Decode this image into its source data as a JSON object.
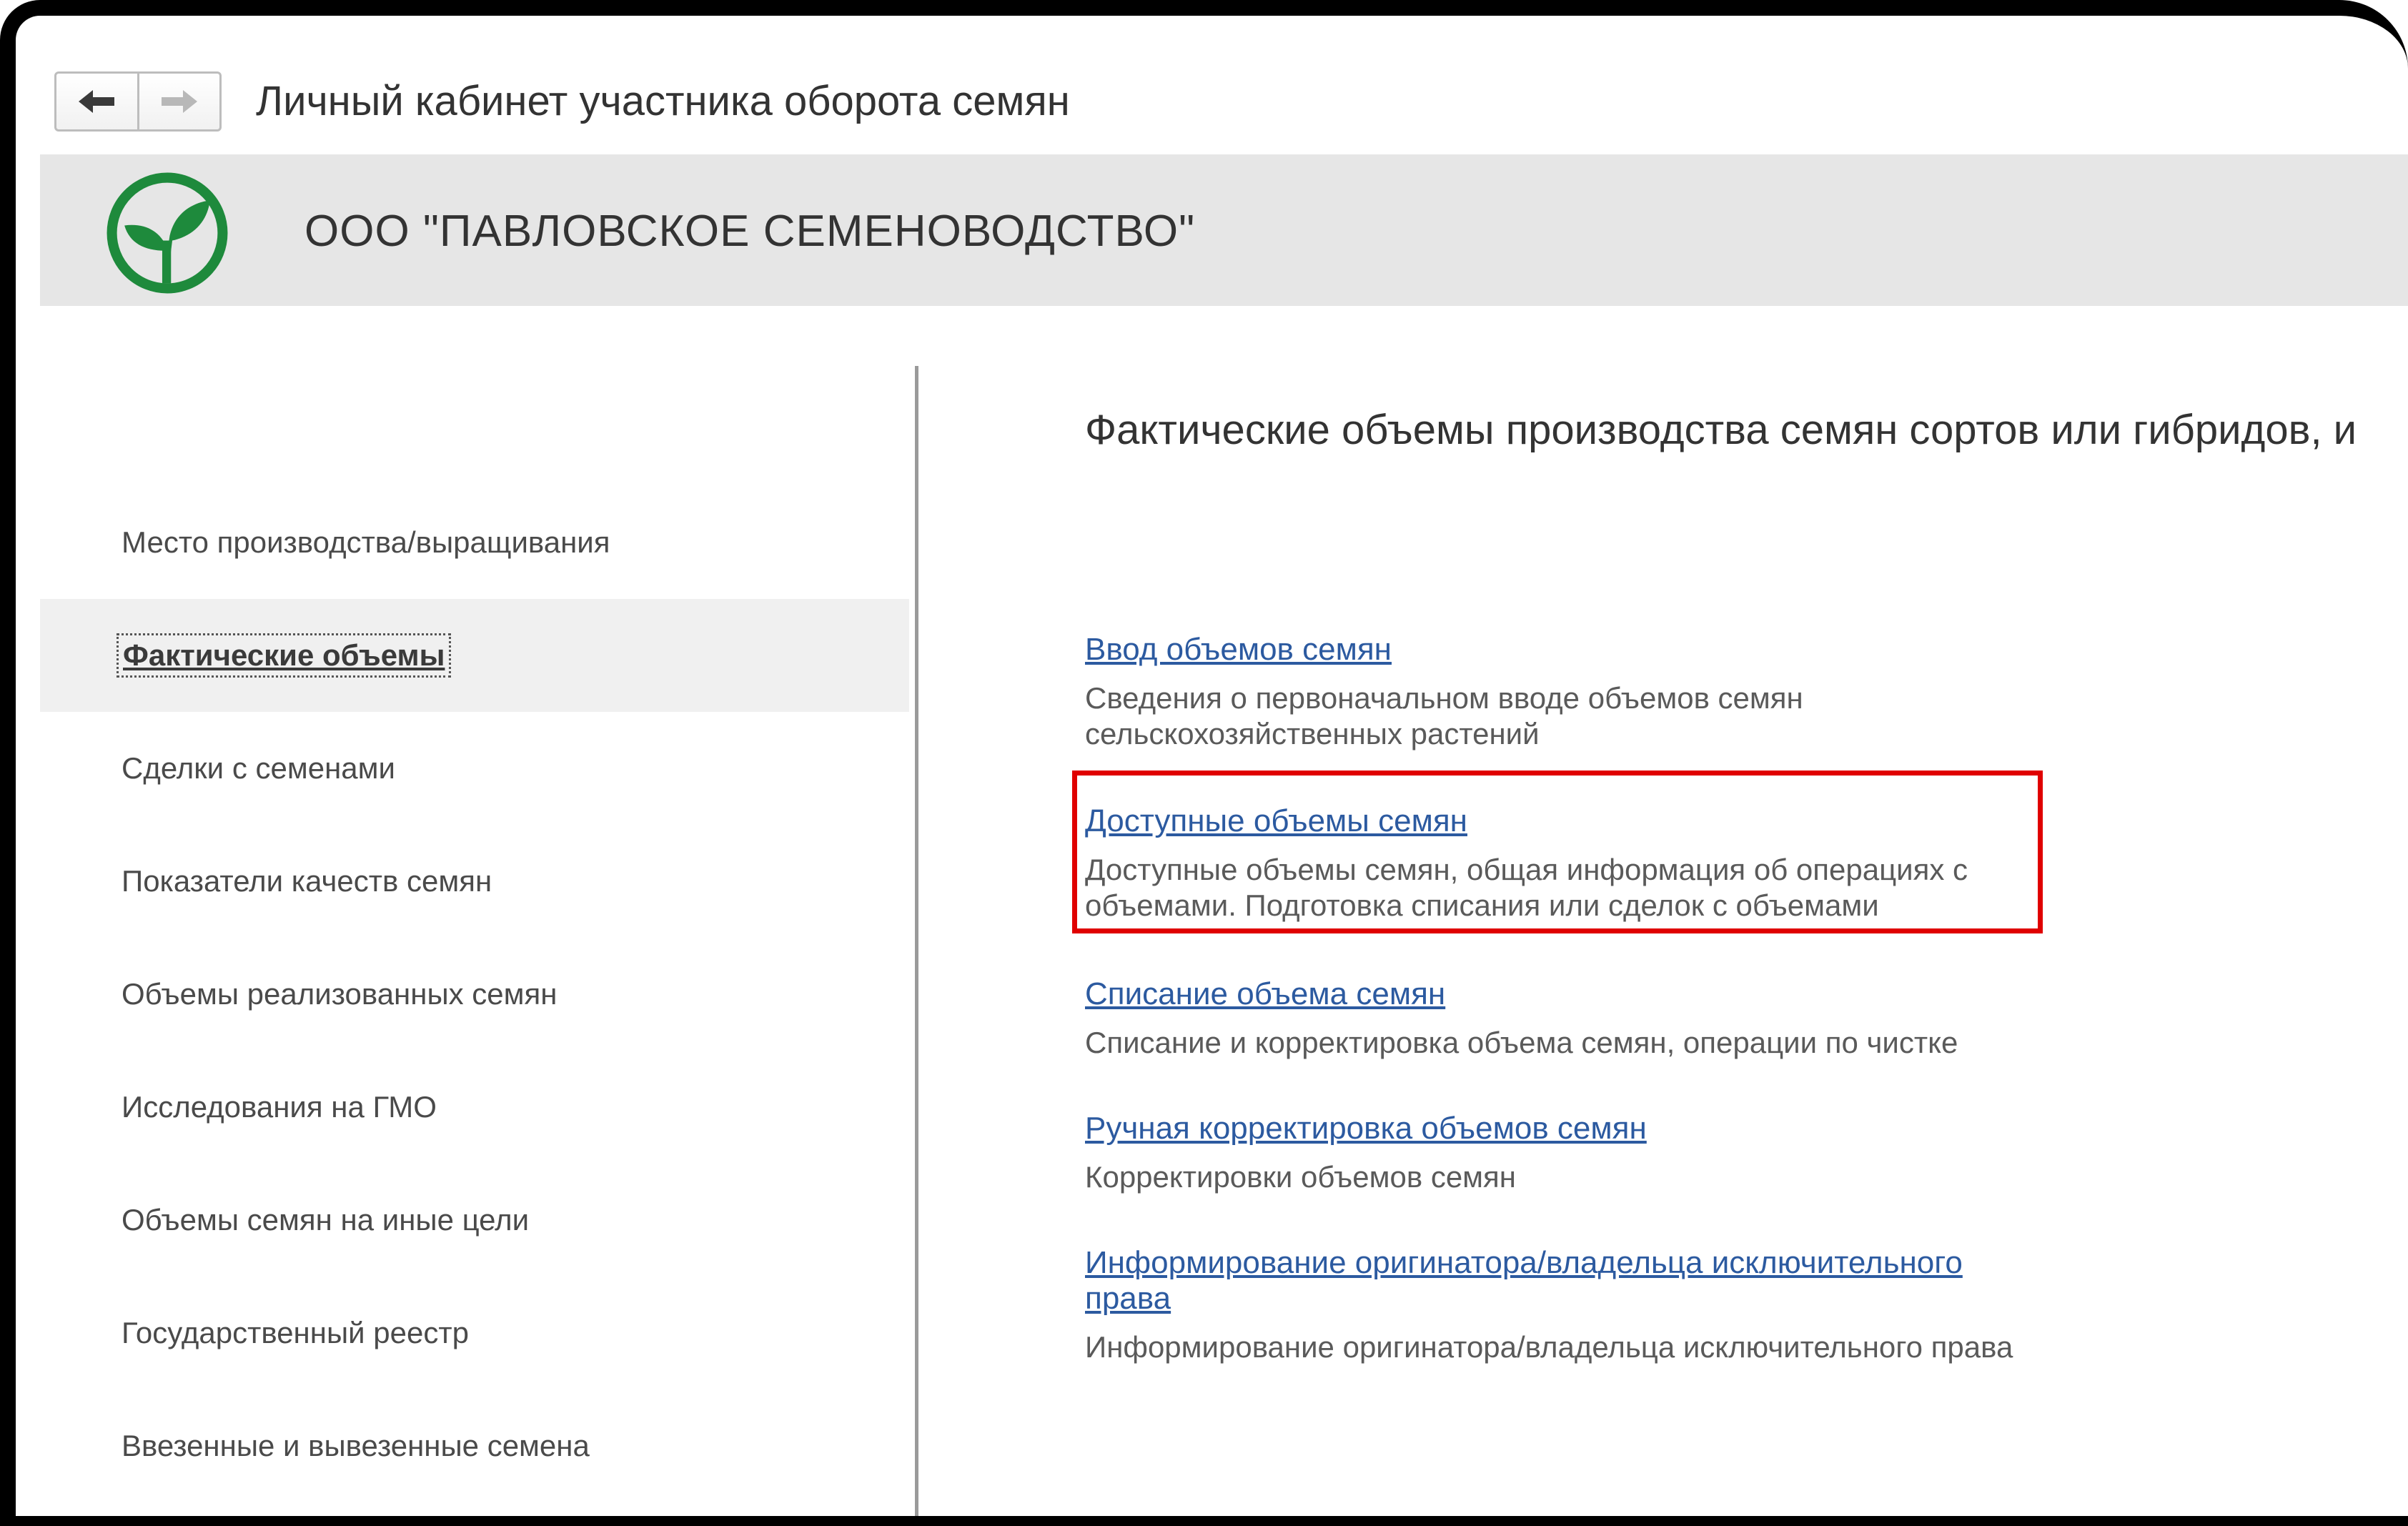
{
  "titlebar": {
    "title": "Личный кабинет участника оборота семян",
    "back_icon": "arrow-left-icon",
    "forward_icon": "arrow-right-icon"
  },
  "org": {
    "name": "ООО \"ПАВЛОВСКОЕ СЕМЕНОВОДСТВО\"",
    "logo_icon": "sprout-logo-icon",
    "logo_color": "#1e8a3c"
  },
  "sidebar": {
    "items": [
      {
        "label": "Место производства/выращивания"
      },
      {
        "label": "Фактические объемы",
        "active": true
      },
      {
        "label": "Сделки с семенами"
      },
      {
        "label": "Показатели качеств семян"
      },
      {
        "label": "Объемы реализованных семян"
      },
      {
        "label": "Исследования на ГМО"
      },
      {
        "label": "Объемы семян на иные цели"
      },
      {
        "label": "Государственный реестр"
      },
      {
        "label": "Ввезенные и вывезенные семена"
      }
    ]
  },
  "content": {
    "title": "Фактические объемы производства семян сортов или гибридов, и",
    "entries": [
      {
        "link": "Ввод объемов семян",
        "desc": "Сведения о первоначальном вводе объемов семян сельскохозяйственных растений"
      },
      {
        "link": "Доступные объемы семян",
        "desc": "Доступные объемы семян, общая информация об операциях с объемами. Подготовка списания или сделок с объемами",
        "highlighted": true
      },
      {
        "link": "Списание объема семян",
        "desc": "Списание и корректировка объема семян, операции по чистке"
      },
      {
        "link": "Ручная корректировка объемов семян",
        "desc": "Корректировки объемов семян"
      },
      {
        "link": "Информирование оригинатора/владельца исключительного права",
        "desc": "Информирование оригинатора/владельца исключительного права"
      }
    ]
  },
  "colors": {
    "link": "#2c5aa0",
    "highlight_border": "#e00000",
    "header_bg": "#e6e6e6",
    "active_item_bg": "#f0f0f0"
  }
}
